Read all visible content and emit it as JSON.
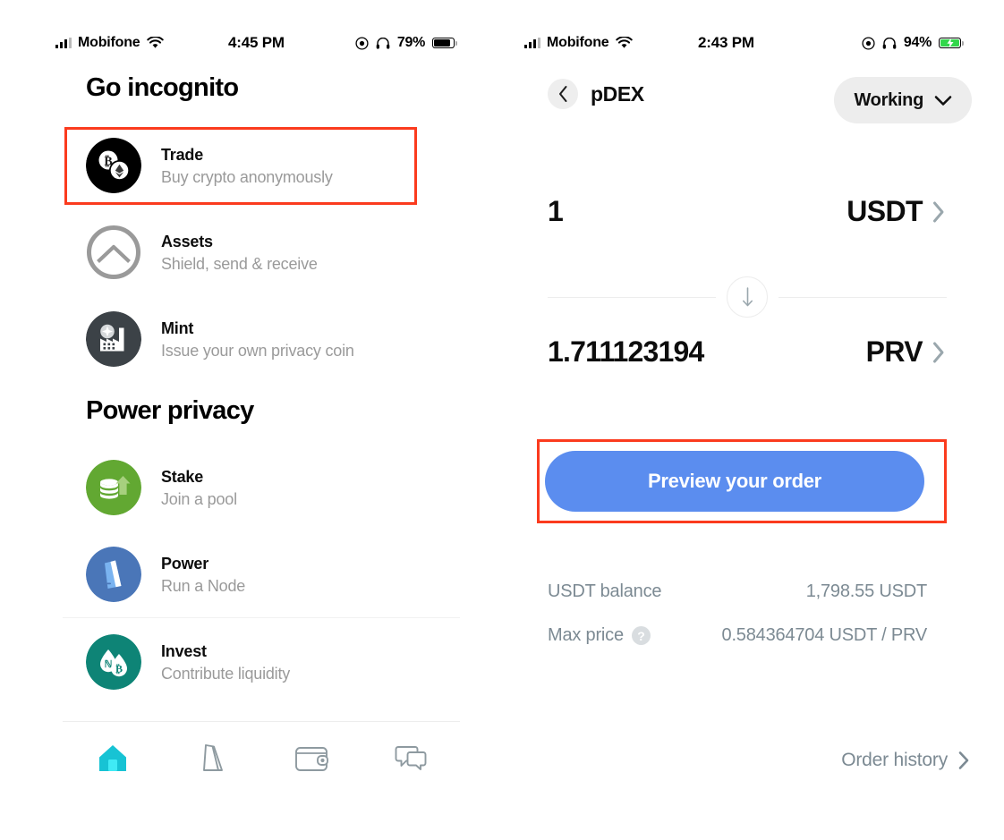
{
  "left_phone": {
    "status_bar": {
      "carrier": "Mobifone",
      "time": "4:45 PM",
      "battery_pct": "79%",
      "battery_charging": false,
      "icons": [
        "signal-bars-icon",
        "wifi-icon",
        "location-icon",
        "headphones-icon",
        "battery-icon"
      ]
    },
    "sections": [
      {
        "title": "Go incognito",
        "items": [
          {
            "title": "Trade",
            "subtitle": "Buy crypto anonymously",
            "icon": "trade-coins-icon",
            "highlighted": true
          },
          {
            "title": "Assets",
            "subtitle": "Shield, send & receive",
            "icon": "assets-shield-icon",
            "highlighted": false
          },
          {
            "title": "Mint",
            "subtitle": "Issue your own privacy coin",
            "icon": "mint-factory-icon",
            "highlighted": false
          }
        ]
      },
      {
        "title": "Power privacy",
        "items": [
          {
            "title": "Stake",
            "subtitle": "Join a pool",
            "icon": "stake-coins-arrow-icon",
            "highlighted": false
          },
          {
            "title": "Power",
            "subtitle": "Run a Node",
            "icon": "power-node-icon",
            "highlighted": false
          },
          {
            "title": "Invest",
            "subtitle": "Contribute liquidity",
            "icon": "invest-droplets-icon",
            "highlighted": false
          }
        ]
      }
    ],
    "tab_bar": [
      {
        "name": "home-tab",
        "icon": "home-icon",
        "active": true
      },
      {
        "name": "node-tab",
        "icon": "node-icon",
        "active": false
      },
      {
        "name": "wallet-tab",
        "icon": "wallet-icon",
        "active": false
      },
      {
        "name": "chat-tab",
        "icon": "chat-bubbles-icon",
        "active": false
      }
    ]
  },
  "right_phone": {
    "status_bar": {
      "carrier": "Mobifone",
      "time": "2:43 PM",
      "battery_pct": "94%",
      "battery_charging": true
    },
    "header": {
      "back_icon": "chevron-left-icon",
      "title": "pDEX",
      "status_label": "Working",
      "status_chevron": "chevron-down-icon"
    },
    "swap": {
      "from_amount": "1",
      "from_token": "USDT",
      "to_amount": "1.711123194",
      "to_token": "PRV",
      "direction_icon": "arrow-down-icon"
    },
    "primary_button": {
      "label": "Preview your order",
      "color": "#5b8def",
      "highlighted": true
    },
    "details": [
      {
        "label": "USDT balance",
        "value": "1,798.55 USDT",
        "has_help": false
      },
      {
        "label": "Max price",
        "value": "0.584364704 USDT / PRV",
        "has_help": true,
        "help_glyph": "?"
      }
    ],
    "order_history": {
      "label": "Order history",
      "icon": "chevron-right-icon"
    }
  },
  "annotations": {
    "box_color": "#fb3b1e",
    "boxes": [
      "trade-menu-item",
      "preview-your-order-button"
    ]
  }
}
